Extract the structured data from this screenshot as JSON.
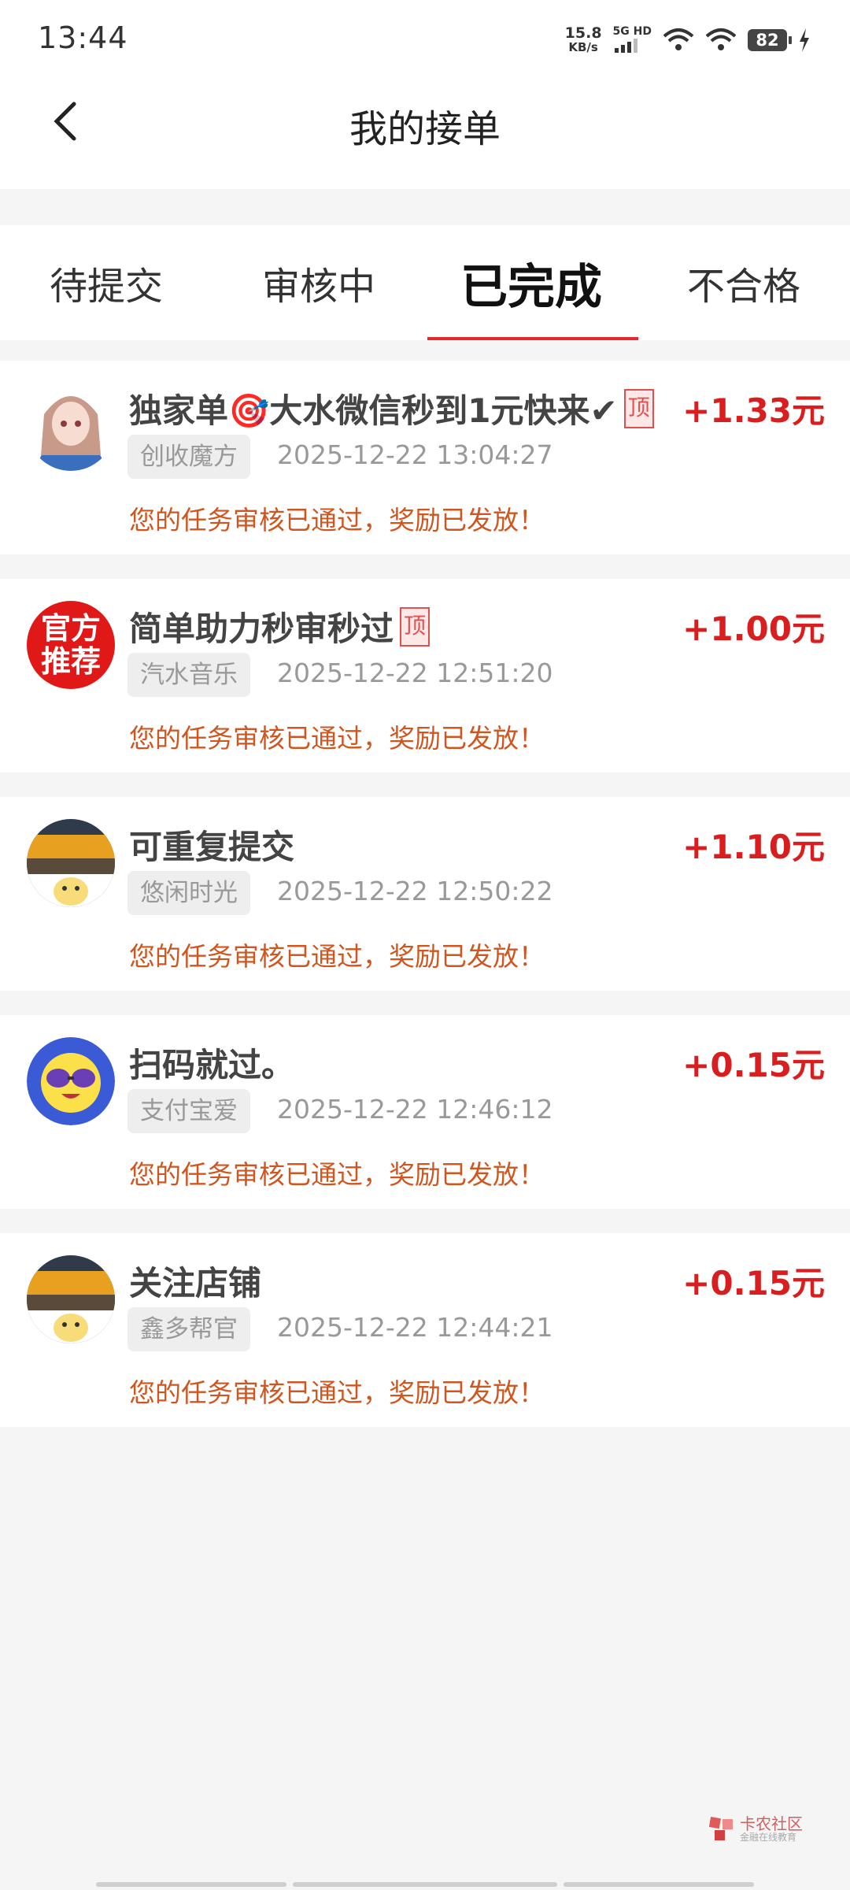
{
  "status": {
    "time": "13:44",
    "speed": "15.8",
    "speed_unit": "KB/s",
    "network": "5G HD",
    "battery": "82"
  },
  "header": {
    "title": "我的接单"
  },
  "tabs": [
    {
      "label": "待提交"
    },
    {
      "label": "审核中"
    },
    {
      "label": "已完成"
    },
    {
      "label": "不合格"
    }
  ],
  "active_tab": "已完成",
  "orders": [
    {
      "title": "独家单🎯大水微信秒到1元快来✔",
      "pinned": true,
      "pin_label": "顶",
      "reward": "+1.33元",
      "source": "创收魔方",
      "time": "2025-12-22 13:04:27",
      "message": "您的任务审核已通过，奖励已发放！",
      "avatar": "anime-girl"
    },
    {
      "title": "简单助力秒审秒过",
      "pinned": true,
      "pin_label": "顶",
      "reward": "+1.00元",
      "source": "汽水音乐",
      "time": "2025-12-22 12:51:20",
      "message": "您的任务审核已通过，奖励已发放！",
      "avatar": "official",
      "avatar_text": "官方推荐"
    },
    {
      "title": "可重复提交",
      "pinned": false,
      "reward": "+1.10元",
      "source": "悠闲时光",
      "time": "2025-12-22 12:50:22",
      "message": "您的任务审核已通过，奖励已发放！",
      "avatar": "sunset-cartoon"
    },
    {
      "title": "扫码就过。",
      "pinned": false,
      "reward": "+0.15元",
      "source": "支付宝爱",
      "time": "2025-12-22 12:46:12",
      "message": "您的任务审核已通过，奖励已发放！",
      "avatar": "sunglasses-emoji"
    },
    {
      "title": "关注店铺",
      "pinned": false,
      "reward": "+0.15元",
      "source": "鑫多帮官",
      "time": "2025-12-22 12:44:21",
      "message": "您的任务审核已通过，奖励已发放！",
      "avatar": "sunset-cartoon"
    }
  ],
  "watermark": {
    "title": "卡农社区",
    "subtitle": "金融在线教育"
  },
  "colors": {
    "accent": "#e5262a",
    "reward": "#d81e1e",
    "message": "#d0561f"
  }
}
